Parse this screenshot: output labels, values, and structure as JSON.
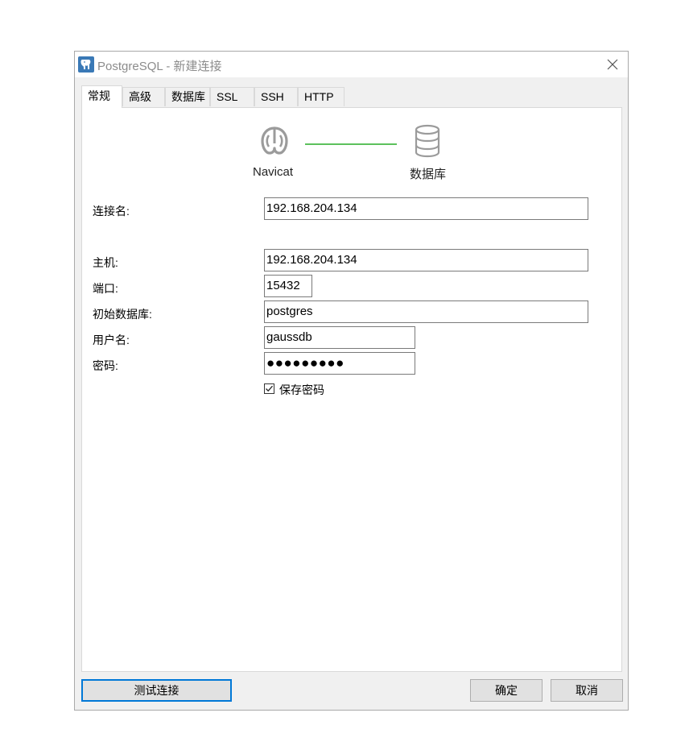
{
  "window": {
    "title": "PostgreSQL - 新建连接"
  },
  "tabs": [
    {
      "label": "常规",
      "active": true
    },
    {
      "label": "高级",
      "active": false
    },
    {
      "label": "数据库",
      "active": false
    },
    {
      "label": "SSL",
      "active": false
    },
    {
      "label": "SSH",
      "active": false
    },
    {
      "label": "HTTP",
      "active": false
    }
  ],
  "diagram": {
    "left_label": "Navicat",
    "right_label": "数据库",
    "line_color": "#5cc15c"
  },
  "form": {
    "connection_name": {
      "label": "连接名:",
      "value": "192.168.204.134"
    },
    "host": {
      "label": "主机:",
      "value": "192.168.204.134"
    },
    "port": {
      "label": "端口:",
      "value": "15432"
    },
    "initial_database": {
      "label": "初始数据库:",
      "value": "postgres"
    },
    "username": {
      "label": "用户名:",
      "value": "gaussdb"
    },
    "password": {
      "label": "密码:",
      "value": "●●●●●●●●●"
    },
    "save_password": {
      "label": "保存密码",
      "checked": true
    }
  },
  "buttons": {
    "test": "测试连接",
    "ok": "确定",
    "cancel": "取消"
  },
  "colors": {
    "accent": "#0078d7",
    "app_icon": "#3a79b6"
  }
}
